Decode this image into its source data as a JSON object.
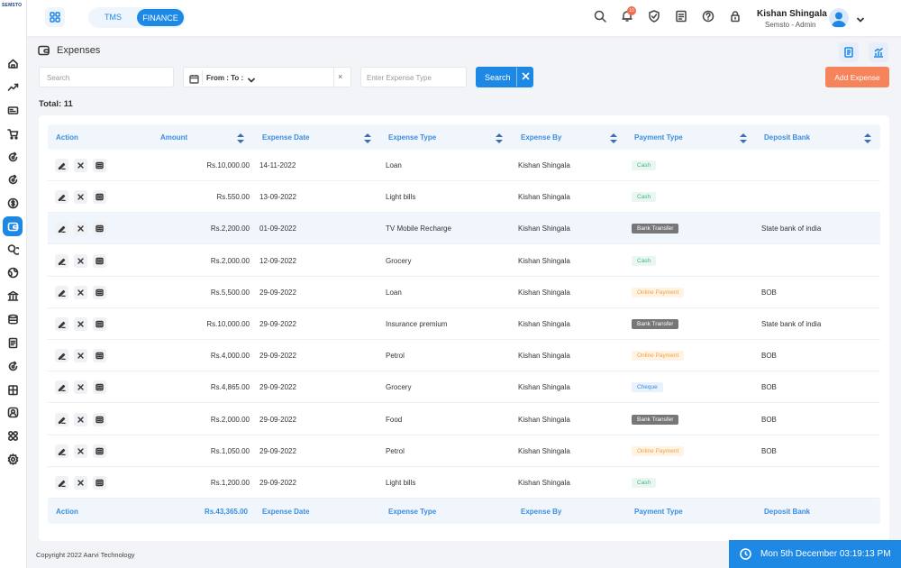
{
  "sidebar": {
    "logo": "SEMSTO",
    "items": [
      {
        "icon": "home-icon"
      },
      {
        "icon": "chart-line-icon"
      },
      {
        "icon": "card-icon"
      },
      {
        "icon": "cart-icon"
      },
      {
        "icon": "refresh-icon"
      },
      {
        "icon": "refresh-icon"
      },
      {
        "icon": "dollar-icon"
      },
      {
        "icon": "wallet-icon"
      },
      {
        "icon": "money-icon"
      },
      {
        "icon": "globe-icon"
      },
      {
        "icon": "bank-icon"
      },
      {
        "icon": "database-icon"
      },
      {
        "icon": "document-icon"
      },
      {
        "icon": "refresh-icon"
      },
      {
        "icon": "building-icon"
      },
      {
        "icon": "user-icon"
      },
      {
        "icon": "apps-icon"
      },
      {
        "icon": "settings-icon"
      }
    ],
    "active_index": 7
  },
  "header": {
    "modes": [
      "TMS",
      "FINANCE"
    ],
    "active_mode": "FINANCE",
    "notification_count": "10",
    "user_name": "Kishan Shingala",
    "user_role": "Semsto - Admin"
  },
  "page": {
    "title": "Expenses",
    "filters": {
      "search_placeholder": "Search",
      "date_label": "From : To :",
      "clear": "×",
      "type_placeholder": "Enter Expense Type",
      "search_button": "Search"
    },
    "add_button": "Add Expense",
    "total": "Total: 11"
  },
  "table": {
    "columns": [
      "Action",
      "Amount",
      "Expense Date",
      "Expense Type",
      "Expense By",
      "Payment Type",
      "Deposit Bank"
    ],
    "rows": [
      {
        "amount": "Rs.10,000.00",
        "date": "14-11-2022",
        "type": "Loan",
        "by": "Kishan Shingala",
        "payment": "Cash",
        "bank": ""
      },
      {
        "amount": "Rs.550.00",
        "date": "13-09-2022",
        "type": "Light bills",
        "by": "Kishan Shingala",
        "payment": "Cash",
        "bank": ""
      },
      {
        "amount": "Rs.2,200.00",
        "date": "01-09-2022",
        "type": "TV Mobile Recharge",
        "by": "Kishan Shingala",
        "payment": "Bank Transfer",
        "bank": "State bank of india"
      },
      {
        "amount": "Rs.2,000.00",
        "date": "12-09-2022",
        "type": "Grocery",
        "by": "Kishan Shingala",
        "payment": "Cash",
        "bank": ""
      },
      {
        "amount": "Rs.5,500.00",
        "date": "29-09-2022",
        "type": "Loan",
        "by": "Kishan Shingala",
        "payment": "Online Payment",
        "bank": "BOB"
      },
      {
        "amount": "Rs.10,000.00",
        "date": "29-09-2022",
        "type": "Insurance premium",
        "by": "Kishan Shingala",
        "payment": "Bank Transfer",
        "bank": "State bank of india"
      },
      {
        "amount": "Rs.4,000.00",
        "date": "29-09-2022",
        "type": "Petrol",
        "by": "Kishan Shingala",
        "payment": "Online Payment",
        "bank": "BOB"
      },
      {
        "amount": "Rs.4,865.00",
        "date": "29-09-2022",
        "type": "Grocery",
        "by": "Kishan Shingala",
        "payment": "Cheque",
        "bank": "BOB"
      },
      {
        "amount": "Rs.2,000.00",
        "date": "29-09-2022",
        "type": "Food",
        "by": "Kishan Shingala",
        "payment": "Bank Transfer",
        "bank": "BOB"
      },
      {
        "amount": "Rs.1,050.00",
        "date": "29-09-2022",
        "type": "Petrol",
        "by": "Kishan Shingala",
        "payment": "Online Payment",
        "bank": "BOB"
      },
      {
        "amount": "Rs.1,200.00",
        "date": "29-09-2022",
        "type": "Light bills",
        "by": "Kishan Shingala",
        "payment": "Cash",
        "bank": ""
      }
    ],
    "highlighted_row": 2,
    "footer": {
      "action": "Action",
      "amount": "Rs.43,365.00",
      "date": "Expense Date",
      "type": "Expense Type",
      "by": "Expense By",
      "payment": "Payment Type",
      "bank": "Deposit Bank"
    },
    "payment_styles": {
      "Cash": "cash",
      "Bank Transfer": "bank",
      "Online Payment": "online",
      "Cheque": "cheque"
    }
  },
  "footer": {
    "copyright": "Copyright 2022 Aarvi Technology",
    "clock": "Mon 5th December 03:19:13 PM"
  },
  "colors": {
    "accent": "#1e88e5",
    "add_button": "#f5845a"
  }
}
